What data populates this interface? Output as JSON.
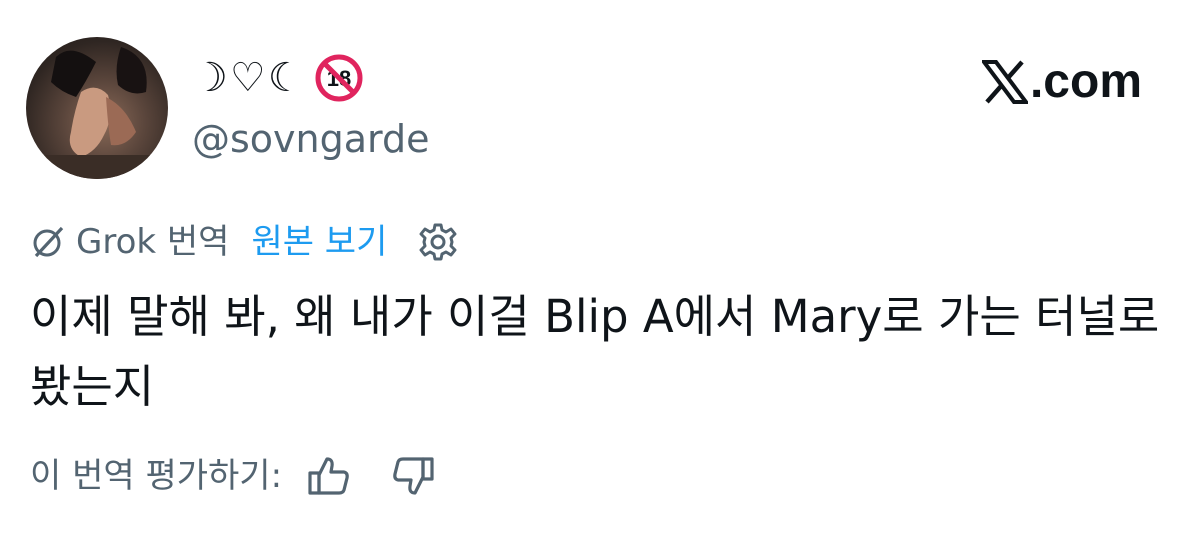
{
  "author": {
    "display_name": "☽♡☾",
    "age_badge": "18",
    "age_badge_icon": "no-under-18-icon",
    "handle": "@sovngarde",
    "avatar_icon": "profile-avatar"
  },
  "brand": {
    "site": ".com",
    "logo_icon": "x-logo-icon"
  },
  "translation": {
    "source_label": "Grok 번역",
    "view_original": "원본 보기",
    "settings_icon": "gear-icon",
    "grok_icon": "grok-icon",
    "link_color": "#1d9bf0"
  },
  "tweet": {
    "text": "이제 말해 봐, 왜 내가 이걸 Blip A에서 Mary로 가는 터널로 봤는지"
  },
  "rating": {
    "label": "이 번역 평가하기:",
    "thumbs_up_icon": "thumbs-up-icon",
    "thumbs_down_icon": "thumbs-down-icon"
  },
  "colors": {
    "primary_text": "#0f1419",
    "secondary_text": "#536471",
    "accent_blue": "#1d9bf0",
    "badge_red": "#e0245e"
  }
}
